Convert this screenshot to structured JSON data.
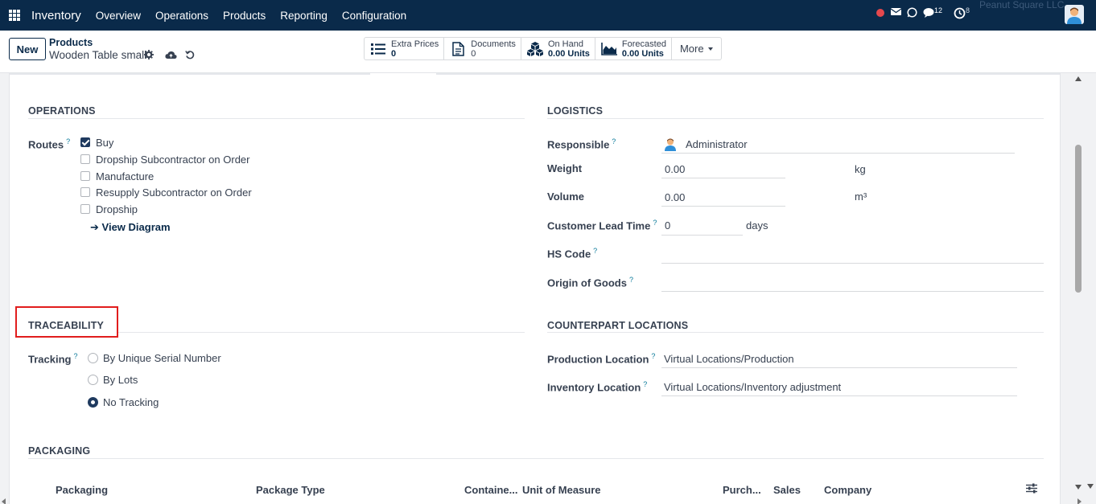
{
  "topbar": {
    "app_name": "Inventory",
    "menu": [
      "Overview",
      "Operations",
      "Products",
      "Reporting",
      "Configuration"
    ],
    "company_faint": "Peanut Square LLC",
    "messages_count": "12",
    "activities_count": "8",
    "colors": {
      "background": "#0a2a4a",
      "status_dot": "#e5484d"
    }
  },
  "control": {
    "new_label": "New",
    "breadcrumb_parent": "Products",
    "breadcrumb_current": "Wooden Table small",
    "smart_buttons": [
      {
        "label": "Extra Prices",
        "value": "0",
        "icon": "list-icon"
      },
      {
        "label": "Documents",
        "value": "0",
        "icon": "document-icon"
      },
      {
        "label": "On Hand",
        "value": "0.00 Units",
        "icon": "cubes-icon"
      },
      {
        "label": "Forecasted",
        "value": "0.00 Units",
        "icon": "area-chart-icon"
      }
    ],
    "more_label": "More"
  },
  "operations": {
    "title": "OPERATIONS",
    "routes_label": "Routes",
    "routes": [
      {
        "label": "Buy",
        "checked": true
      },
      {
        "label": "Dropship Subcontractor on Order",
        "checked": false
      },
      {
        "label": "Manufacture",
        "checked": false
      },
      {
        "label": "Resupply Subcontractor on Order",
        "checked": false
      },
      {
        "label": "Dropship",
        "checked": false
      }
    ],
    "view_diagram": "View Diagram"
  },
  "logistics": {
    "title": "LOGISTICS",
    "responsible_label": "Responsible",
    "responsible_value": "Administrator",
    "weight_label": "Weight",
    "weight_value": "0.00",
    "weight_unit": "kg",
    "volume_label": "Volume",
    "volume_value": "0.00",
    "volume_unit": "m³",
    "lead_time_label": "Customer Lead Time",
    "lead_time_value": "0",
    "lead_time_unit": "days",
    "hs_code_label": "HS Code",
    "hs_code_value": "",
    "origin_label": "Origin of Goods",
    "origin_value": ""
  },
  "traceability": {
    "title": "TRACEABILITY",
    "tracking_label": "Tracking",
    "options": [
      {
        "label": "By Unique Serial Number",
        "checked": false
      },
      {
        "label": "By Lots",
        "checked": false
      },
      {
        "label": "No Tracking",
        "checked": true
      }
    ]
  },
  "counterpart": {
    "title": "COUNTERPART LOCATIONS",
    "production_label": "Production Location",
    "production_value": "Virtual Locations/Production",
    "inventory_label": "Inventory Location",
    "inventory_value": "Virtual Locations/Inventory adjustment"
  },
  "packaging": {
    "title": "PACKAGING",
    "columns": [
      "Packaging",
      "Package Type",
      "Containe...",
      "Unit of Measure",
      "Purch...",
      "Sales",
      "Company"
    ]
  },
  "colors": {
    "highlight": "#e11d1d",
    "accent": "#1f3a5f",
    "help": "#0a7a9a"
  }
}
